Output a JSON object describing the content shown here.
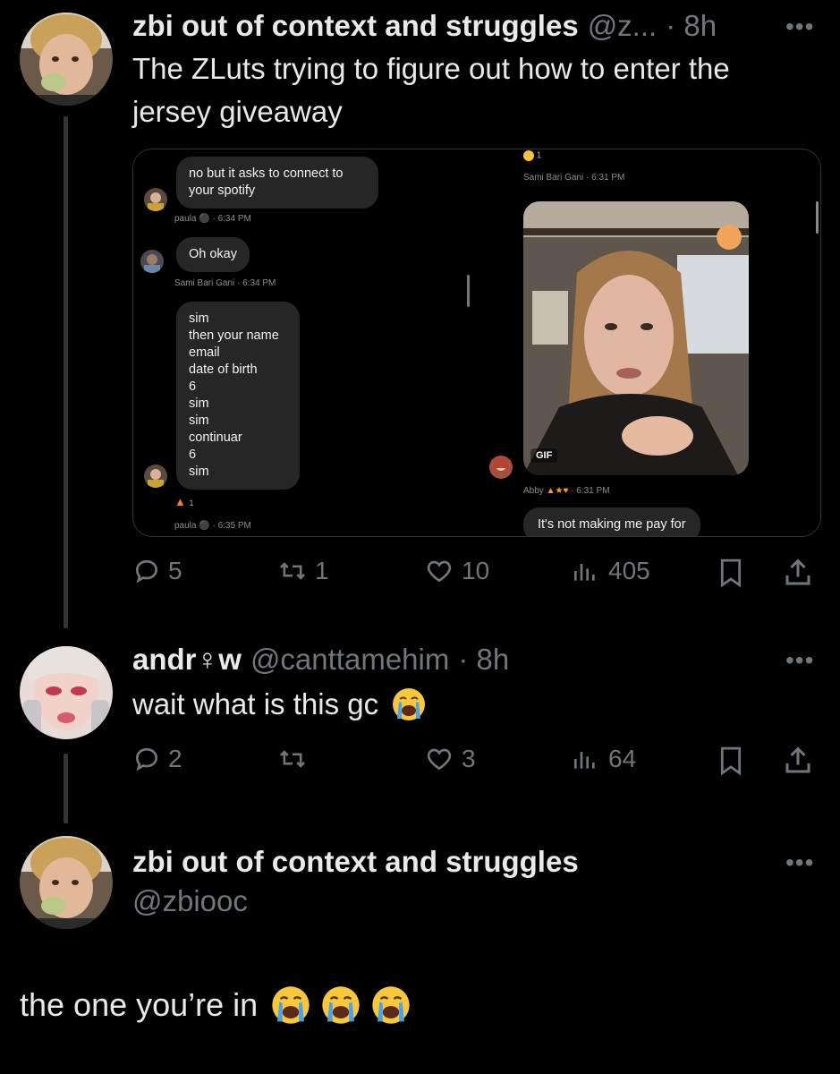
{
  "tweet1": {
    "display_name": "zbi out of context and struggles",
    "handle": "@z...",
    "time": "· 8h",
    "text_line1": "The ZLuts trying to figure out how to enter the",
    "text_line2": "jersey giveaway",
    "actions": {
      "replies": "5",
      "retweets": "1",
      "likes": "10",
      "views": "405"
    }
  },
  "media": {
    "left": {
      "bubble1": "no but it asks to connect to your spotify",
      "meta1_name": "paula",
      "meta1_time": "· 6:34 PM",
      "bubble2": "Oh okay",
      "meta2": "Sami Bari Gani · 6:34 PM",
      "bubble3_lines": [
        "sim",
        "then your name",
        "email",
        "date of birth",
        "6",
        "sim",
        "sim",
        "continuar",
        "6",
        "sim"
      ],
      "reaction_count": "1",
      "meta3_name": "paula",
      "meta3_time": "· 6:35 PM"
    },
    "right": {
      "reaction_count": "1",
      "meta_top": "Sami Bari Gani · 6:31 PM",
      "gif_label": "GIF",
      "meta_bottom_name": "Abby",
      "meta_bottom_time": "· 6:31 PM",
      "bubble": "It's not making me pay for"
    }
  },
  "tweet2": {
    "display_name": "andr♀w",
    "handle": "@canttamehim",
    "time": "· 8h",
    "text": "wait what is this gc",
    "actions": {
      "replies": "2",
      "retweets": "",
      "likes": "3",
      "views": "64"
    }
  },
  "tweet3": {
    "display_name": "zbi out of context and struggles",
    "handle": "@zbiooc",
    "text": "the one you’re in"
  },
  "icons": {
    "reply": "reply-icon",
    "retweet": "retweet-icon",
    "like": "heart-icon",
    "views": "views-icon",
    "bookmark": "bookmark-icon",
    "share": "share-icon",
    "more": "more-icon",
    "emoji": "loudly-crying-face-icon"
  },
  "colors": {
    "background": "#000000",
    "text": "#e7e9ea",
    "muted": "#71767b",
    "thread": "#333639"
  }
}
